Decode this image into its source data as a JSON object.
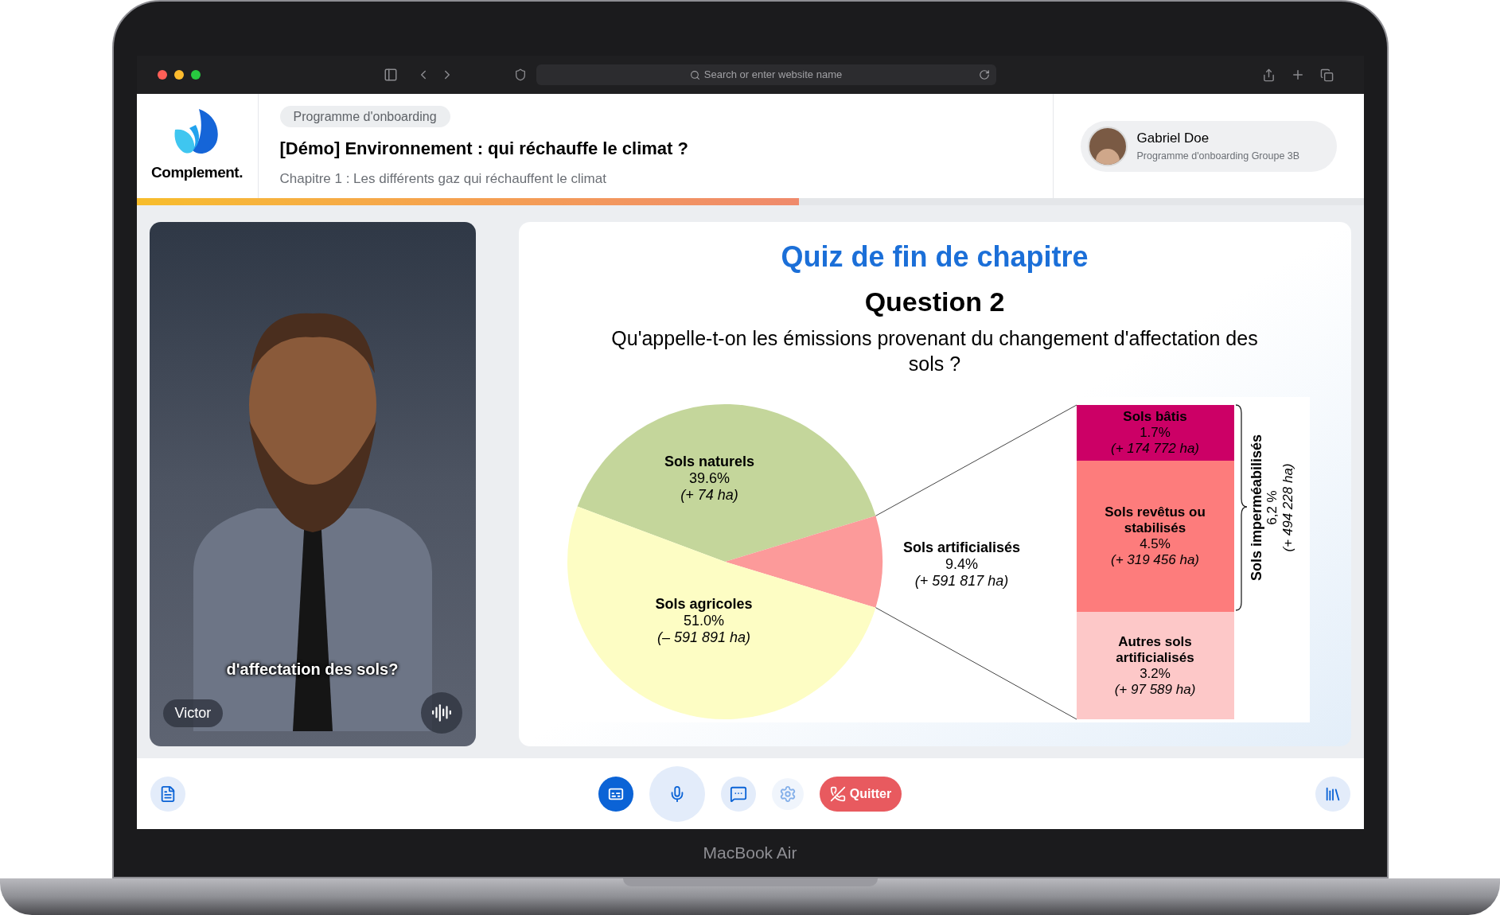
{
  "browser": {
    "address_placeholder": "Search or enter website name"
  },
  "header": {
    "logo_text": "Complement.",
    "badge": "Programme d'onboarding",
    "title": "[Démo] Environnement : qui réchauffe le climat ?",
    "subtitle": "Chapitre 1 : Les différents gaz qui réchauffent le climat",
    "user": {
      "name": "Gabriel Doe",
      "group": "Programme d'onboarding Groupe 3B"
    }
  },
  "progress": {
    "level": 0.54
  },
  "video": {
    "caption": "d'affectation des sols?",
    "speaker": "Victor"
  },
  "slide": {
    "heading": "Quiz de fin de chapitre",
    "question_label": "Question 2",
    "question": "Qu'appelle-t-on les émissions provenant du changement d'affectation des sols ?",
    "chart_data": {
      "type": "pie",
      "categories": [
        "Sols naturels",
        "Sols artificialisés",
        "Sols agricoles"
      ],
      "values": [
        39.6,
        9.4,
        51.0
      ]
    },
    "slices": [
      {
        "percent": "39.6%",
        "area": "(+ 74 ha)",
        "color": "#c4d69b"
      },
      {
        "percent": "9.4%",
        "area": "(+ 591 817 ha)",
        "color": "#fc9a9a"
      },
      {
        "percent": "51.0%",
        "area": "(– 591 891 ha)",
        "color": "#fdfdc4"
      }
    ],
    "breakdown": [
      {
        "title": "Sols bâtis",
        "percent": "1.7%",
        "area": "(+ 174 772 ha)",
        "color": "#cc0066"
      },
      {
        "title": "Sols revêtus ou stabilisés",
        "percent": "4.5%",
        "area": "(+ 319 456 ha)",
        "color": "#fd7c7c"
      },
      {
        "title": "Autres sols artificialisés",
        "percent": "3.2%",
        "area": "(+ 97 589 ha)",
        "color": "#fdc8c8"
      }
    ],
    "bracket": {
      "title": "Sols imperméabilisés",
      "value": "6,2 %",
      "area": "(+ 494 228 ha)"
    }
  },
  "controls": [
    {
      "kind": "captions",
      "on": true,
      "disabled": false
    },
    {
      "kind": "microphone",
      "on": true,
      "disabled": false
    },
    {
      "kind": "chat",
      "on": false,
      "disabled": false
    },
    {
      "kind": "settings",
      "on": false,
      "disabled": true
    }
  ],
  "quit_label": "Quitter",
  "device_label": "MacBook Air"
}
